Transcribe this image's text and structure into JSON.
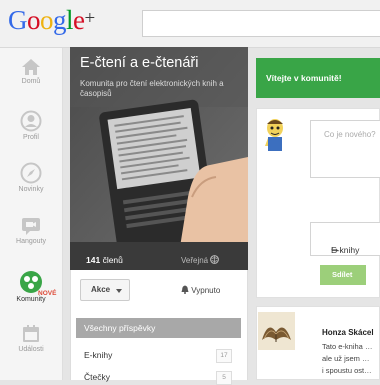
{
  "header": {
    "logo": {
      "google": "Google",
      "plus": "+",
      "colors": {
        "G": "#3369e8",
        "o1": "#d50f25",
        "o2": "#eeb211",
        "g": "#3369e8",
        "l": "#009925",
        "e": "#d50f25"
      }
    }
  },
  "nav": {
    "items": [
      {
        "label": "Domů",
        "icon": "home-icon"
      },
      {
        "label": "Profil",
        "icon": "profile-icon"
      },
      {
        "label": "Novinky",
        "icon": "compass-icon"
      },
      {
        "label": "Hangouty",
        "icon": "hangouts-icon"
      },
      {
        "label": "Komunity",
        "icon": "communities-icon",
        "badge": "NOVÉ",
        "active": true
      },
      {
        "label": "Události",
        "icon": "calendar-icon"
      }
    ]
  },
  "community": {
    "title": "E-čtení a e-čtenáři",
    "subtitle": "Komunita pro čtení elektronických knih a časopisů",
    "members_count": "141",
    "members_label": "členů",
    "visibility": "Veřejná",
    "actions_label": "Akce",
    "leave_label": "Vypnuto",
    "categories": [
      {
        "label": "Všechny příspěvky",
        "selected": true
      },
      {
        "label": "E-knihy",
        "count": "17"
      },
      {
        "label": "Čtečky",
        "count": "5"
      }
    ]
  },
  "welcome": {
    "text": "Vítejte v komunitě!"
  },
  "compose": {
    "placeholder": "Co je nového?",
    "link_label": "E-knihy",
    "share_label": "Sdílet"
  },
  "post": {
    "author": "Honza Skácel",
    "lines": [
      "Tato e-kniha …",
      "ale už jsem …",
      "i spoustu ost…"
    ]
  },
  "colors": {
    "accent_green": "#39a547",
    "share_green": "#9ccf7a",
    "card_dark": "#262626"
  }
}
